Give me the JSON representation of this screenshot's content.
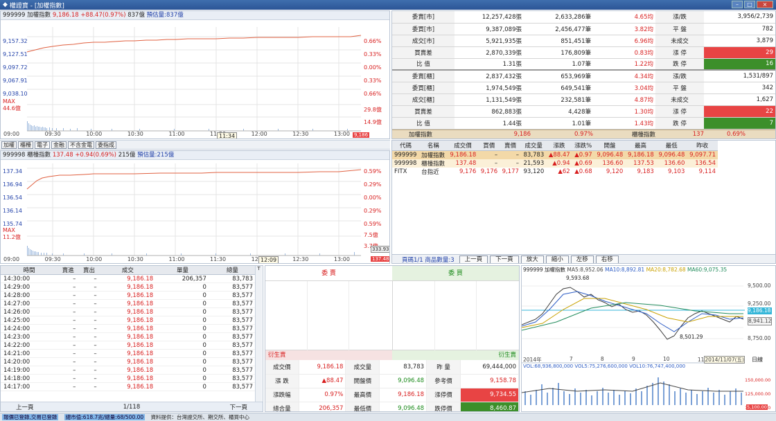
{
  "window": {
    "title": "權證寶 - [加權指數]",
    "min": "–",
    "max": "□",
    "close": "×"
  },
  "chart1": {
    "header": {
      "code": "999999 加權指數",
      "price": "9,186.18",
      "change": "+88.47(0.97%)",
      "volume": "837億",
      "est": "預估量:837億"
    },
    "ylabels": [
      "9,157.32",
      "9,127.51",
      "9,097.72",
      "9,067.91",
      "9,038.10"
    ],
    "rlabels": [
      "0.66%",
      "0.33%",
      "0.00%",
      "0.33%",
      "0.66%"
    ],
    "vol": {
      "max_label": "MAX",
      "max_val": "44.6億",
      "r1": "29.8億",
      "r2": "14.9億"
    },
    "xlabels": [
      "09:00",
      "09:30",
      "10:00",
      "10:30",
      "11:00",
      "11:30",
      "12:00",
      "12:30",
      "13:00"
    ],
    "cursor": "11:34",
    "endval": "9,186"
  },
  "toolbar": {
    "b1": "加權",
    "b2": "櫃檯",
    "b3": "電子",
    "b4": "金融",
    "b5": "不含金電",
    "b6": "委指成"
  },
  "chart2": {
    "header": {
      "code": "999998 櫃檯指數",
      "price": "137.48",
      "change": "+0.94(0.69%)",
      "volume": "215億",
      "est": "預估量:215億"
    },
    "ylabels": [
      "137.34",
      "136.94",
      "136.54",
      "136.14",
      "135.74"
    ],
    "rlabels": [
      "0.59%",
      "0.29%",
      "0.00%",
      "0.29%",
      "0.59%"
    ],
    "vol": {
      "max_label": "MAX",
      "max_val": "11.2億",
      "r1": "7.5億",
      "r2": "3.7億"
    },
    "xlabels": [
      "09:00",
      "09:30",
      "10:00",
      "10:30",
      "11:00",
      "11:30",
      "12:00",
      "12:30",
      "13:00"
    ],
    "cursor": "12:09",
    "endval": "137.48",
    "lastvol": "333.93"
  },
  "summary": {
    "rows": [
      {
        "l1": "委賣[市]",
        "v1": "12,257,428張",
        "v2": "2,633,286筆",
        "v3": "4.65均",
        "l2": "漲/跌",
        "v4": "3,956/2,739",
        "c": "n"
      },
      {
        "l1": "委買[市]",
        "v1": "9,387,089張",
        "v2": "2,456,477筆",
        "v3": "3.82均",
        "l2": "平 盤",
        "v4": "782",
        "c": "n"
      },
      {
        "l1": "成交[市]",
        "v1": "5,921,935張",
        "v2": "851,451筆",
        "v3": "6.96均",
        "l2": "未成交",
        "v4": "3,879",
        "c": "n"
      },
      {
        "l1": "買賣差",
        "v1": "2,870,339張",
        "v2": "176,809筆",
        "v3": "0.83均",
        "l2": "漲 停",
        "v4": "29",
        "c": "up"
      },
      {
        "l1": "比 值",
        "v1": "1.31張",
        "v2": "1.07筆",
        "v3": "1.22均",
        "l2": "跌 停",
        "v4": "16",
        "c": "dn"
      },
      {
        "l1": "委賣[櫃]",
        "v1": "2,837,432張",
        "v2": "653,969筆",
        "v3": "4.34均",
        "l2": "漲/跌",
        "v4": "1,531/897",
        "c": "n"
      },
      {
        "l1": "委買[櫃]",
        "v1": "1,974,549張",
        "v2": "649,541筆",
        "v3": "3.04均",
        "l2": "平 盤",
        "v4": "342",
        "c": "n"
      },
      {
        "l1": "成交[櫃]",
        "v1": "1,131,549張",
        "v2": "232,581筆",
        "v3": "4.87均",
        "l2": "未成交",
        "v4": "1,627",
        "c": "n"
      },
      {
        "l1": "買賣差",
        "v1": "862,883張",
        "v2": "4,428筆",
        "v3": "1.30均",
        "l2": "漲 停",
        "v4": "22",
        "c": "up"
      },
      {
        "l1": "比 值",
        "v1": "1.44張",
        "v2": "1.01筆",
        "v3": "1.43均",
        "l2": "跌 停",
        "v4": "7",
        "c": "dn"
      }
    ],
    "footer": {
      "a": "加權指數",
      "b": "9,186",
      "c": "0.97%",
      "d": "櫃檯指數",
      "e": "137",
      "f": "0.69%"
    }
  },
  "quote": {
    "headers": [
      "代碼",
      "名稱",
      "成交價",
      "買價",
      "賣價",
      "成交量",
      "漲跌",
      "漲跌%",
      "開盤",
      "最高",
      "最低",
      "昨收"
    ],
    "rows": [
      [
        "999999",
        "加權指數",
        "9,186.18",
        "–",
        "–",
        "83,783",
        "▲88.47",
        "▲0.97",
        "9,096.48",
        "9,186.18",
        "9,096.48",
        "9,097.71"
      ],
      [
        "999998",
        "櫃檯指數",
        "137.48",
        "–",
        "–",
        "21,593",
        "▲0.94",
        "▲0.69",
        "136.60",
        "137.53",
        "136.60",
        "136.54"
      ],
      [
        "FITX",
        "台指近",
        "9,176",
        "9,176",
        "9,177",
        "93,120",
        "▲62",
        "▲0.68",
        "9,120",
        "9,183",
        "9,103",
        "9,114"
      ]
    ],
    "page_text": "頁碼1/1 商品數量:3",
    "btn_prev": "上一頁",
    "btn_next": "下一頁",
    "btn_zoomin": "放大",
    "btn_zoomout": "縮小",
    "btn_left": "左移",
    "btn_right": "右移"
  },
  "ticks": {
    "headers": [
      "時間",
      "賣進",
      "賣出",
      "成交",
      "單量",
      "總量"
    ],
    "corner": "T",
    "rows": [
      [
        "14:30:00",
        "–",
        "–",
        "9,186.18",
        "206,357",
        "83,783"
      ],
      [
        "14:29:00",
        "–",
        "–",
        "9,186.18",
        "0",
        "83,577"
      ],
      [
        "14:28:00",
        "–",
        "–",
        "9,186.18",
        "0",
        "83,577"
      ],
      [
        "14:27:00",
        "–",
        "–",
        "9,186.18",
        "0",
        "83,577"
      ],
      [
        "14:26:00",
        "–",
        "–",
        "9,186.18",
        "0",
        "83,577"
      ],
      [
        "14:25:00",
        "–",
        "–",
        "9,186.18",
        "0",
        "83,577"
      ],
      [
        "14:24:00",
        "–",
        "–",
        "9,186.18",
        "0",
        "83,577"
      ],
      [
        "14:23:00",
        "–",
        "–",
        "9,186.18",
        "0",
        "83,577"
      ],
      [
        "14:22:00",
        "–",
        "–",
        "9,186.18",
        "0",
        "83,577"
      ],
      [
        "14:21:00",
        "–",
        "–",
        "9,186.18",
        "0",
        "83,577"
      ],
      [
        "14:20:00",
        "–",
        "–",
        "9,186.18",
        "0",
        "83,577"
      ],
      [
        "14:19:00",
        "–",
        "–",
        "9,186.18",
        "0",
        "83,577"
      ],
      [
        "14:18:00",
        "–",
        "–",
        "9,186.18",
        "0",
        "83,577"
      ],
      [
        "14:17:00",
        "–",
        "–",
        "9,186.18",
        "0",
        "83,577"
      ]
    ],
    "prev": "上一頁",
    "page": "1/118",
    "next": "下一頁"
  },
  "book": {
    "sell_header": "委 賣",
    "buy_header": "委 買",
    "deriv_l": "衍生賣",
    "deriv_r": "衍生賣",
    "rows": [
      [
        "成交價",
        "9,186.18",
        "成交量",
        "83,783",
        "昨 量",
        "69,444,000"
      ],
      [
        "漲 跌",
        "▲88.47",
        "開盤價",
        "9,096.48",
        "參考價",
        "9,158.78"
      ],
      [
        "漲跌幅",
        "0.97%",
        "最高價",
        "9,186.18",
        "漲停價",
        "9,734.55"
      ],
      [
        "總合量",
        "206,357",
        "最低價",
        "9,096.48",
        "跌停價",
        "8,460.87"
      ]
    ]
  },
  "kline": {
    "header": "999999 加權指數",
    "ma5": "MA5:8,952.06",
    "ma10": "MA10:8,892.81",
    "ma20": "MA20:8,782.68",
    "ma60": "MA60:9,075.35",
    "high": "9,593.68",
    "low": "8,501.29",
    "ylabels": [
      "9,500.00",
      "9,250.00",
      "9,186.18",
      "8,941.12",
      "8,750.00"
    ],
    "xlabels": [
      "2014年",
      "7",
      "8",
      "9",
      "10",
      "11"
    ],
    "date": "2014/11/07(五)",
    "period": "日線",
    "vol_line": "VOL:68,936,800,000 VOL5:75,276,600,000 VOL10:76,747,400,000",
    "vol_ylabels": [
      "150,000.00",
      "125,000.00",
      "100,000.00"
    ],
    "vol_last": "5,100.00"
  },
  "status": {
    "a": "報價已登錄,交易已登錄",
    "b": "總市值:618.7兆/總量:68/500.00",
    "c": "資料提供：台灣證交所、期交所、櫃買中心"
  }
}
